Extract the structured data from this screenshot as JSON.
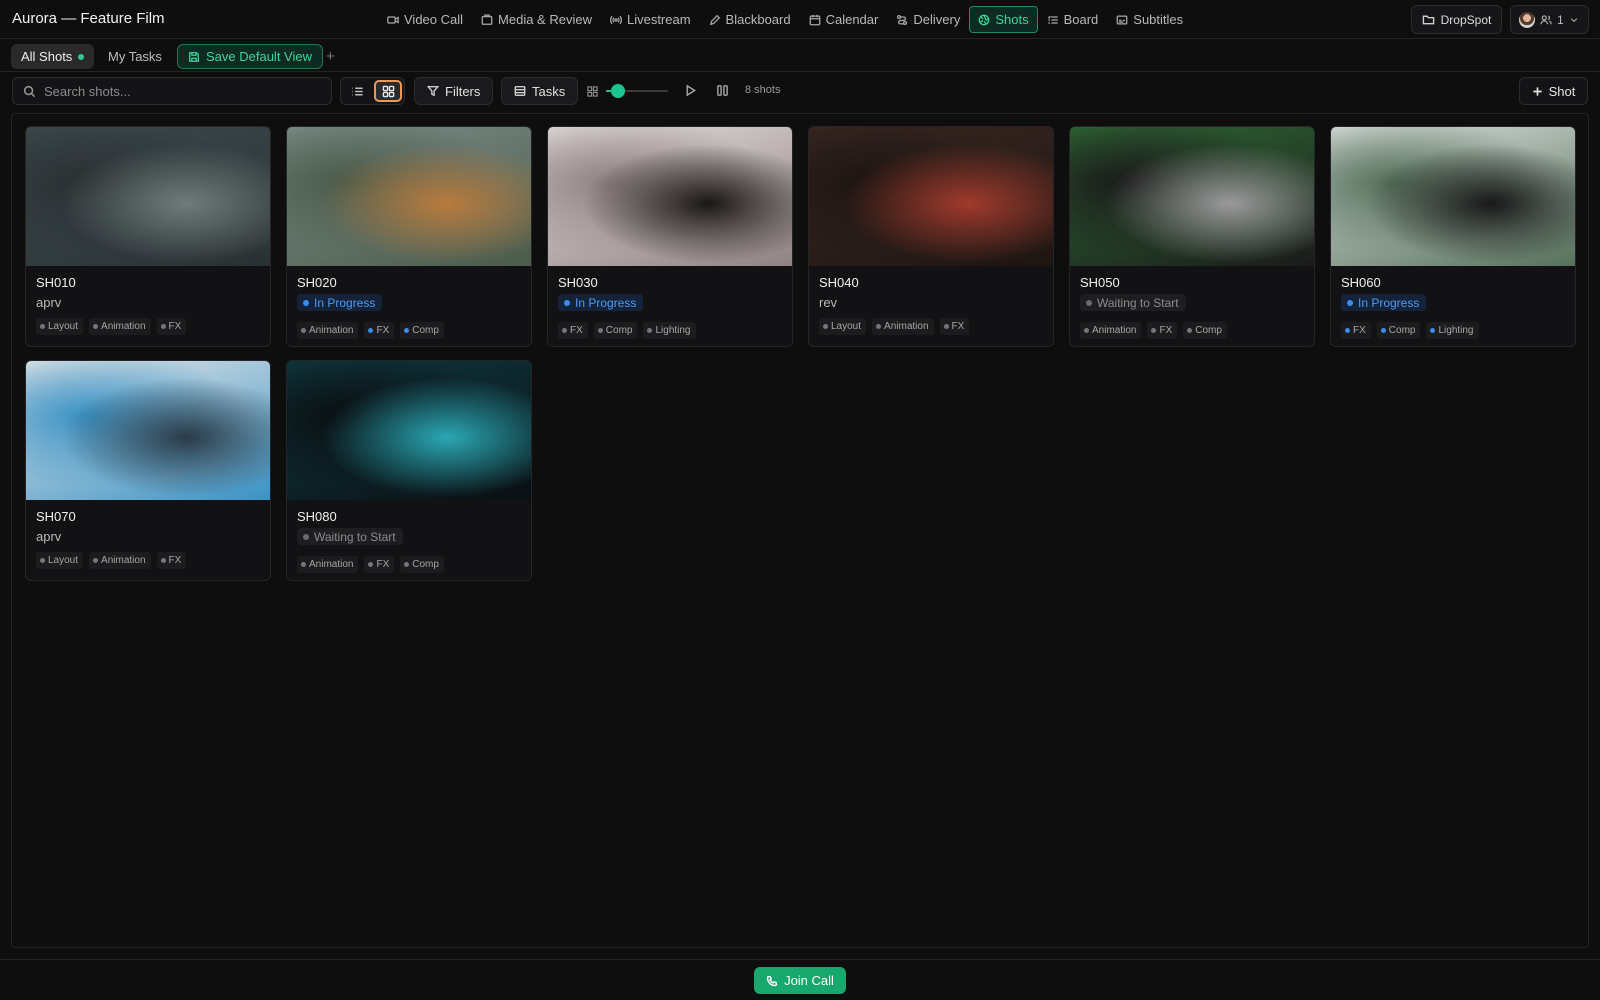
{
  "app": {
    "title": "Aurora — Feature Film"
  },
  "nav": [
    {
      "label": "Video Call",
      "icon": "video-icon"
    },
    {
      "label": "Media & Review",
      "icon": "media-icon"
    },
    {
      "label": "Livestream",
      "icon": "broadcast-icon"
    },
    {
      "label": "Blackboard",
      "icon": "pen-icon"
    },
    {
      "label": "Calendar",
      "icon": "calendar-icon"
    },
    {
      "label": "Delivery",
      "icon": "route-icon"
    },
    {
      "label": "Shots",
      "icon": "aperture-icon",
      "active": true
    },
    {
      "label": "Board",
      "icon": "list-icon"
    },
    {
      "label": "Subtitles",
      "icon": "subtitles-icon"
    }
  ],
  "header_right": {
    "dropspot_label": "DropSpot",
    "user_count": "1"
  },
  "views": {
    "all_label": "All Shots",
    "mine_label": "My Tasks",
    "save_label": "Save Default View",
    "add_label": "+"
  },
  "toolbar": {
    "search_placeholder": "Search shots...",
    "filters_label": "Filters",
    "tasks_label": "Tasks",
    "thumb_size_fraction": 0.2,
    "shot_count": "8 shots",
    "add_shot_label": "Shot",
    "active_view": "grid"
  },
  "shots": [
    {
      "name": "SH010",
      "status": "aprv",
      "status_kind": "text",
      "tags": [
        {
          "label": "Layout",
          "color": "gray"
        },
        {
          "label": "Animation",
          "color": "gray"
        },
        {
          "label": "FX",
          "color": "gray"
        }
      ],
      "palette": [
        "#3d4a4e",
        "#6f7b7a",
        "#2a3134"
      ]
    },
    {
      "name": "SH020",
      "status": "In Progress",
      "status_kind": "progress",
      "tags": [
        {
          "label": "Animation",
          "color": "gray"
        },
        {
          "label": "FX",
          "color": "blue"
        },
        {
          "label": "Comp",
          "color": "blue"
        }
      ],
      "palette": [
        "#7e8d8a",
        "#b87a3c",
        "#4a5b4a"
      ]
    },
    {
      "name": "SH030",
      "status": "In Progress",
      "status_kind": "progress",
      "tags": [
        {
          "label": "FX",
          "color": "gray"
        },
        {
          "label": "Comp",
          "color": "gray"
        },
        {
          "label": "Lighting",
          "color": "gray"
        }
      ],
      "palette": [
        "#e6dede",
        "#1b1716",
        "#8f8282"
      ]
    },
    {
      "name": "SH040",
      "status": "rev",
      "status_kind": "text",
      "tags": [
        {
          "label": "Layout",
          "color": "gray"
        },
        {
          "label": "Animation",
          "color": "gray"
        },
        {
          "label": "FX",
          "color": "gray"
        }
      ],
      "palette": [
        "#3b2822",
        "#a03a2c",
        "#1d1512"
      ]
    },
    {
      "name": "SH050",
      "status": "Waiting to Start",
      "status_kind": "waiting",
      "tags": [
        {
          "label": "Animation",
          "color": "gray"
        },
        {
          "label": "FX",
          "color": "gray"
        },
        {
          "label": "Comp",
          "color": "gray"
        }
      ],
      "palette": [
        "#2f6b35",
        "#9a9a9a",
        "#1a1a1a"
      ]
    },
    {
      "name": "SH060",
      "status": "In Progress",
      "status_kind": "progress",
      "tags": [
        {
          "label": "FX",
          "color": "blue"
        },
        {
          "label": "Comp",
          "color": "blue"
        },
        {
          "label": "Lighting",
          "color": "blue"
        }
      ],
      "palette": [
        "#dfe4e2",
        "#181818",
        "#55705a"
      ]
    },
    {
      "name": "SH070",
      "status": "aprv",
      "status_kind": "text",
      "tags": [
        {
          "label": "Layout",
          "color": "gray"
        },
        {
          "label": "Animation",
          "color": "gray"
        },
        {
          "label": "FX",
          "color": "gray"
        }
      ],
      "palette": [
        "#e8e8e8",
        "#2a3b48",
        "#3a92c5"
      ]
    },
    {
      "name": "SH080",
      "status": "Waiting to Start",
      "status_kind": "waiting",
      "tags": [
        {
          "label": "Animation",
          "color": "gray"
        },
        {
          "label": "FX",
          "color": "gray"
        },
        {
          "label": "Comp",
          "color": "gray"
        }
      ],
      "palette": [
        "#0f3a42",
        "#2aa7b4",
        "#0a0f12"
      ]
    }
  ],
  "footer": {
    "join_label": "Join Call"
  },
  "colors": {
    "accent": "#1cc58e",
    "in_progress": "#3b8bf0",
    "active_toggle_border": "#e79a55"
  }
}
